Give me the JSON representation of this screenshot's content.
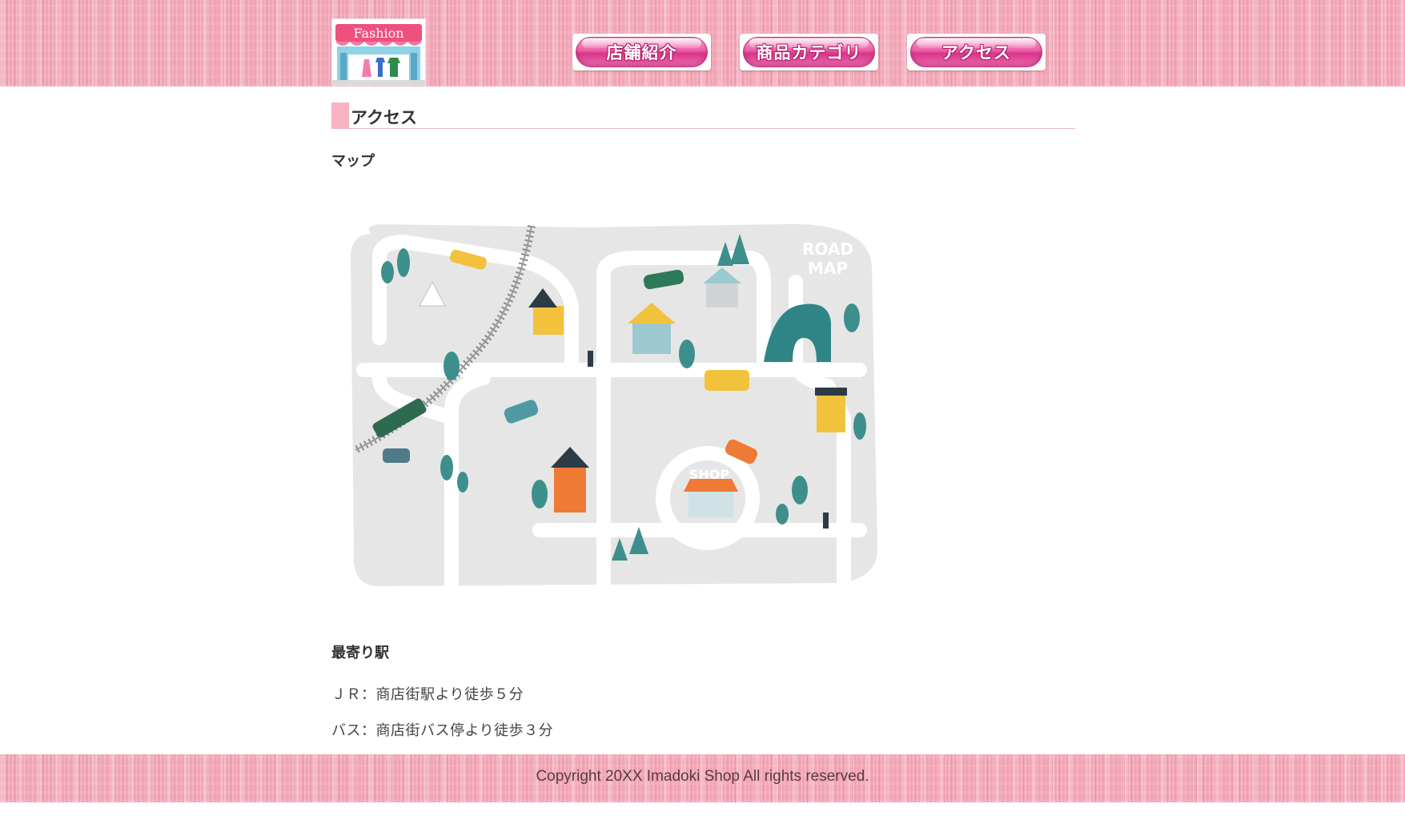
{
  "header": {
    "logo_text": "Fashion",
    "nav": [
      {
        "label": "店舗紹介"
      },
      {
        "label": "商品カテゴリ"
      },
      {
        "label": "アクセス"
      }
    ]
  },
  "main": {
    "section_title": "アクセス",
    "map_heading": "マップ",
    "map_labels": {
      "road_map_1": "ROAD",
      "road_map_2": "MAP",
      "shop": "SHOP"
    },
    "station_heading": "最寄り駅",
    "access_lines": [
      "ＪＲ：商店街駅より徒歩５分",
      "バス：商店街バス停より徒歩３分"
    ]
  },
  "footer": {
    "copyright": "Copyright 20XX Imadoki Shop All rights reserved."
  },
  "colors": {
    "accent_pink": "#f7b3c2",
    "button_pink": "#ec5ea6",
    "map_teal": "#3d8f8c"
  }
}
